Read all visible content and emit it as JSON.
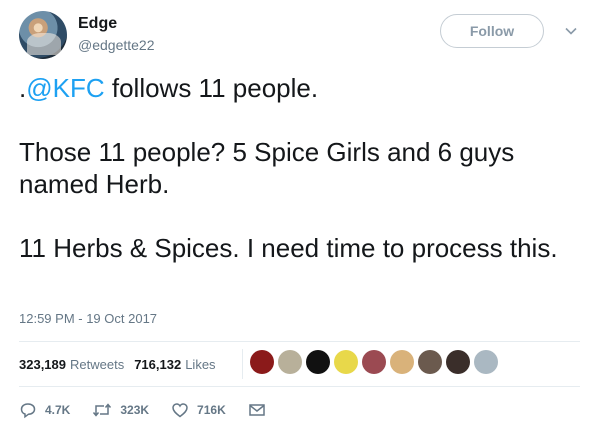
{
  "user": {
    "name": "Edge",
    "handle": "@edgette22",
    "follow_label": "Follow"
  },
  "tweet": {
    "prefix": ".",
    "mention": "@KFC",
    "line1_rest": " follows 11 people.",
    "para2": "Those 11 people? 5 Spice Girls and 6 guys named Herb.",
    "para3": "11 Herbs & Spices. I need time to process this.",
    "timestamp": "12:59 PM - 19 Oct 2017"
  },
  "stats": {
    "retweets_count": "323,189",
    "retweets_label": "Retweets",
    "likes_count": "716,132",
    "likes_label": "Likes"
  },
  "likers": [
    {
      "icon": "liker-avatar",
      "color": "#8b1a1a"
    },
    {
      "icon": "liker-avatar",
      "color": "#b8b09a"
    },
    {
      "icon": "liker-avatar",
      "color": "#111111"
    },
    {
      "icon": "liker-avatar",
      "color": "#e8d84a"
    },
    {
      "icon": "liker-avatar",
      "color": "#9b4a52"
    },
    {
      "icon": "liker-avatar",
      "color": "#d9b27a"
    },
    {
      "icon": "liker-avatar",
      "color": "#6b5a4e"
    },
    {
      "icon": "liker-avatar",
      "color": "#3a2e2a"
    },
    {
      "icon": "liker-avatar",
      "color": "#aab8c2"
    }
  ],
  "actions": {
    "replies": "4.7K",
    "retweets": "323K",
    "likes": "716K"
  },
  "colors": {
    "link": "#1da1f2",
    "secondary_text": "#657786",
    "divider": "#e6ecf0"
  }
}
